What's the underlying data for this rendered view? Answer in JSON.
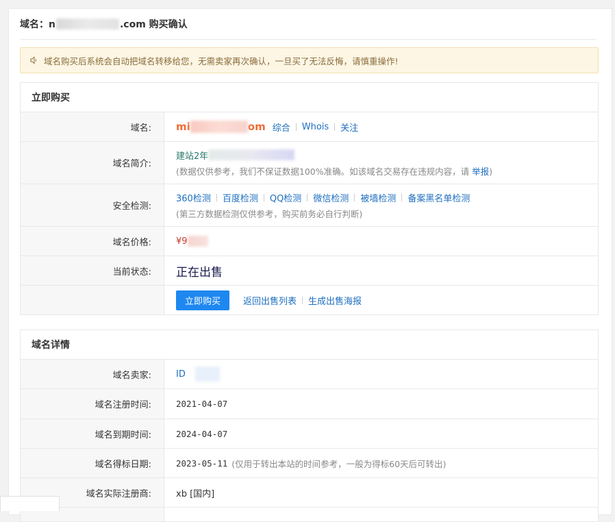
{
  "page": {
    "title_prefix": "域名：n",
    "title_suffix": ".com 购买确认"
  },
  "notice": {
    "icon": "speaker-icon",
    "text": "域名购买后系统会自动把域名转移给您，无需卖家再次确认，一旦买了无法反悔，请慎重操作!"
  },
  "buy_section": {
    "title": "立即购买",
    "domain_label": "域名:",
    "domain_prefix": "mi",
    "domain_suffix": "om",
    "domain_links": [
      "综合",
      "Whois",
      "关注"
    ],
    "intro_label": "域名简介:",
    "intro_text": "建站2年",
    "intro_note_prefix": "(数据仅供参考，我们不保证数据100%准确。如该域名交易存在违规内容，请 ",
    "intro_report": "举报",
    "intro_note_suffix": ")",
    "security_label": "安全检测:",
    "security_links": [
      "360检测",
      "百度检测",
      "QQ检测",
      "微信检测",
      "被墙检测",
      "备案黑名单检测"
    ],
    "security_note": "(第三方数据检测仅供参考，购买前务必自行判断)",
    "price_label": "域名价格:",
    "price_prefix": "¥9",
    "status_label": "当前状态:",
    "status_value": "正在出售",
    "buy_button": "立即购买",
    "back_link": "返回出售列表",
    "poster_link": "生成出售海报"
  },
  "detail_section": {
    "title": "域名详情",
    "seller_label": "域名卖家:",
    "seller_value": "ID",
    "reg_label": "域名注册时间:",
    "reg_value": "2021-04-07",
    "exp_label": "域名到期时间:",
    "exp_value": "2024-04-07",
    "win_label": "域名得标日期:",
    "win_value": "2023-05-11",
    "win_note": "(仅用于转出本站的时间参考，一般为得标60天后可转出)",
    "registrar_label": "域名实际注册商:",
    "registrar_value": "xb [国内]"
  },
  "colors": {
    "link": "#1e6fc0",
    "domain": "#f06b35",
    "button": "#1e88f0",
    "notice_bg": "#fdf6e5"
  }
}
